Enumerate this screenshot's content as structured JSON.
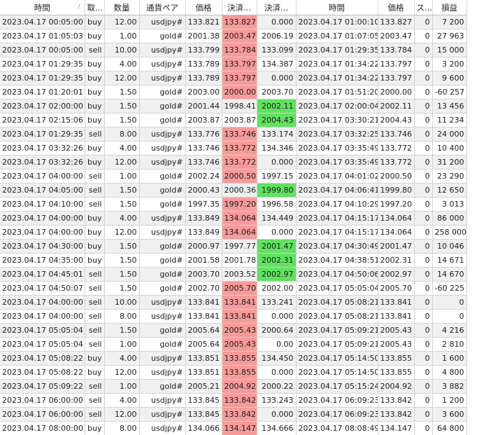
{
  "headers": [
    "時間",
    "取...",
    "数量",
    "通貨ペア",
    "価格",
    "決済...",
    "決済...",
    "時間",
    "価格",
    "ス...",
    "損益"
  ],
  "sort_indicator": "/",
  "rows": [
    [
      "2023.04.17 00:05:00",
      "buy",
      "12.00",
      "usdjpy#",
      "133.821",
      "133.827",
      "0.000",
      "2023.04.17 01:00:10",
      "133.827",
      "0",
      "7 200"
    ],
    [
      "2023.04.17 01:05:03",
      "buy",
      "1.00",
      "gold#",
      "2001.38",
      "2003.47",
      "2006.19",
      "2023.04.17 01:07:05",
      "2003.47",
      "0",
      "27 963"
    ],
    [
      "2023.04.17 00:05:00",
      "sell",
      "10.00",
      "usdjpy#",
      "133.799",
      "133.784",
      "133.099",
      "2023.04.17 01:29:35",
      "133.784",
      "0",
      "15 000"
    ],
    [
      "2023.04.17 01:29:35",
      "buy",
      "4.00",
      "usdjpy#",
      "133.789",
      "133.797",
      "134.387",
      "2023.04.17 01:34:22",
      "133.797",
      "0",
      "3 200"
    ],
    [
      "2023.04.17 01:29:35",
      "buy",
      "12.00",
      "usdjpy#",
      "133.789",
      "133.797",
      "0.000",
      "2023.04.17 01:34:22",
      "133.797",
      "0",
      "9 600"
    ],
    [
      "2023.04.17 01:20:01",
      "buy",
      "1.50",
      "gold#",
      "2003.00",
      "2000.00",
      "2003.70",
      "2023.04.17 01:51:20",
      "2000.00",
      "0",
      "-60 257"
    ],
    [
      "2023.04.17 02:00:00",
      "buy",
      "1.50",
      "gold#",
      "2001.44",
      "1998.41",
      "2002.11",
      "2023.04.17 02:00:04",
      "2002.11",
      "0",
      "13 456"
    ],
    [
      "2023.04.17 02:15:06",
      "buy",
      "1.50",
      "gold#",
      "2003.87",
      "2003.87",
      "2004.43",
      "2023.04.17 03:30:21",
      "2004.43",
      "0",
      "11 234"
    ],
    [
      "2023.04.17 01:29:35",
      "sell",
      "8.00",
      "usdjpy#",
      "133.776",
      "133.746",
      "133.174",
      "2023.04.17 03:32:25",
      "133.746",
      "0",
      "24 000"
    ],
    [
      "2023.04.17 03:32:26",
      "buy",
      "4.00",
      "usdjpy#",
      "133.746",
      "133.772",
      "134.346",
      "2023.04.17 03:35:49",
      "133.772",
      "0",
      "10 400"
    ],
    [
      "2023.04.17 03:32:26",
      "buy",
      "12.00",
      "usdjpy#",
      "133.746",
      "133.772",
      "0.000",
      "2023.04.17 03:35:49",
      "133.772",
      "0",
      "31 200"
    ],
    [
      "2023.04.17 04:00:00",
      "sell",
      "1.00",
      "gold#",
      "2002.24",
      "2000.50",
      "1997.15",
      "2023.04.17 04:01:02",
      "2000.50",
      "0",
      "23 290"
    ],
    [
      "2023.04.17 04:05:00",
      "sell",
      "1.50",
      "gold#",
      "2000.43",
      "2000.36",
      "1999.80",
      "2023.04.17 04:06:41",
      "1999.80",
      "0",
      "12 650"
    ],
    [
      "2023.04.17 04:10:00",
      "sell",
      "1.50",
      "gold#",
      "1997.35",
      "1997.20",
      "1996.58",
      "2023.04.17 04:10:29",
      "1997.20",
      "0",
      "3 013"
    ],
    [
      "2023.04.17 04:00:00",
      "buy",
      "4.00",
      "usdjpy#",
      "133.849",
      "134.064",
      "134.449",
      "2023.04.17 04:15:17",
      "134.064",
      "0",
      "86 000"
    ],
    [
      "2023.04.17 04:00:00",
      "buy",
      "12.00",
      "usdjpy#",
      "133.849",
      "134.064",
      "0.000",
      "2023.04.17 04:15:17",
      "134.064",
      "0",
      "258 000"
    ],
    [
      "2023.04.17 04:30:00",
      "buy",
      "1.50",
      "gold#",
      "2000.97",
      "1997.77",
      "2001.47",
      "2023.04.17 04:30:49",
      "2001.47",
      "0",
      "10 046"
    ],
    [
      "2023.04.17 04:35:00",
      "buy",
      "1.50",
      "gold#",
      "2001.58",
      "2001.78",
      "2002.31",
      "2023.04.17 04:38:51",
      "2002.31",
      "0",
      "14 671"
    ],
    [
      "2023.04.17 04:45:01",
      "sell",
      "1.50",
      "gold#",
      "2003.70",
      "2003.52",
      "2002.97",
      "2023.04.17 04:50:06",
      "2002.97",
      "0",
      "14 670"
    ],
    [
      "2023.04.17 04:50:07",
      "sell",
      "1.50",
      "gold#",
      "2002.70",
      "2005.70",
      "2002.00",
      "2023.04.17 05:05:04",
      "2005.70",
      "0",
      "-60 225"
    ],
    [
      "2023.04.17 04:00:00",
      "sell",
      "10.00",
      "usdjpy#",
      "133.841",
      "133.841",
      "133.241",
      "2023.04.17 05:08:21",
      "133.841",
      "0",
      "0"
    ],
    [
      "2023.04.17 04:00:00",
      "sell",
      "8.00",
      "usdjpy#",
      "133.841",
      "133.841",
      "0.000",
      "2023.04.17 05:08:21",
      "133.841",
      "0",
      "0"
    ],
    [
      "2023.04.17 05:05:04",
      "sell",
      "1.50",
      "gold#",
      "2005.64",
      "2005.43",
      "2000.64",
      "2023.04.17 05:09:21",
      "2005.43",
      "0",
      "4 216"
    ],
    [
      "2023.04.17 05:05:04",
      "sell",
      "1.00",
      "gold#",
      "2005.64",
      "2005.43",
      "0.00",
      "2023.04.17 05:09:21",
      "2005.43",
      "0",
      "2 810"
    ],
    [
      "2023.04.17 05:08:22",
      "buy",
      "4.00",
      "usdjpy#",
      "133.851",
      "133.855",
      "134.450",
      "2023.04.17 05:14:50",
      "133.855",
      "0",
      "1 600"
    ],
    [
      "2023.04.17 05:08:22",
      "buy",
      "12.00",
      "usdjpy#",
      "133.851",
      "133.855",
      "0.000",
      "2023.04.17 05:14:50",
      "133.855",
      "0",
      "4 800"
    ],
    [
      "2023.04.17 05:09:22",
      "sell",
      "1.00",
      "gold#",
      "2005.21",
      "2004.92",
      "2000.22",
      "2023.04.17 05:15:24",
      "2004.92",
      "0",
      "3 882"
    ],
    [
      "2023.04.17 06:00:00",
      "sell",
      "4.00",
      "usdjpy#",
      "133.845",
      "133.842",
      "133.243",
      "2023.04.17 06:09:23",
      "133.842",
      "0",
      "1 200"
    ],
    [
      "2023.04.17 06:00:00",
      "sell",
      "12.00",
      "usdjpy#",
      "133.845",
      "133.842",
      "0.000",
      "2023.04.17 06:09:23",
      "133.842",
      "0",
      "3 600"
    ],
    [
      "2023.04.17 08:00:00",
      "buy",
      "8.00",
      "usdjpy#",
      "134.066",
      "134.147",
      "134.666",
      "2023.04.17 08:08:49",
      "134.147",
      "0",
      "64 800"
    ]
  ],
  "highlights": {
    "red": "#f89a9a",
    "green": "#60e260",
    "sl_hit_rows": [
      0,
      1,
      2,
      3,
      4,
      5,
      8,
      9,
      10,
      11,
      13,
      14,
      15,
      19,
      20,
      21,
      22,
      23,
      24,
      25,
      26,
      27,
      28,
      29
    ],
    "tp_hit_rows": [
      6,
      7,
      12,
      16,
      17,
      18
    ]
  }
}
